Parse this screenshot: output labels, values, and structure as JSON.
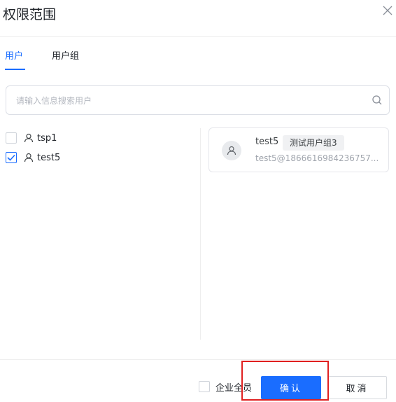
{
  "dialog": {
    "title": "权限范围",
    "close_icon": "close-icon"
  },
  "tabs": [
    {
      "label": "用户",
      "active": true
    },
    {
      "label": "用户组",
      "active": false
    }
  ],
  "search": {
    "placeholder": "请输入信息搜索用户",
    "value": "",
    "icon": "search-icon"
  },
  "users": [
    {
      "name": "tsp1",
      "checked": false,
      "icon": "person-icon"
    },
    {
      "name": "test5",
      "checked": true,
      "icon": "person-icon"
    }
  ],
  "selected": [
    {
      "name": "test5",
      "group": "测试用户组3",
      "email": "test5@1866616984236757...",
      "icon": "avatar-icon"
    }
  ],
  "footer": {
    "all_members_label": "企业全员",
    "all_members_checked": false,
    "confirm_label": "确认",
    "cancel_label": "取消"
  },
  "colors": {
    "accent": "#1a6dff",
    "highlight": "#e02020"
  }
}
